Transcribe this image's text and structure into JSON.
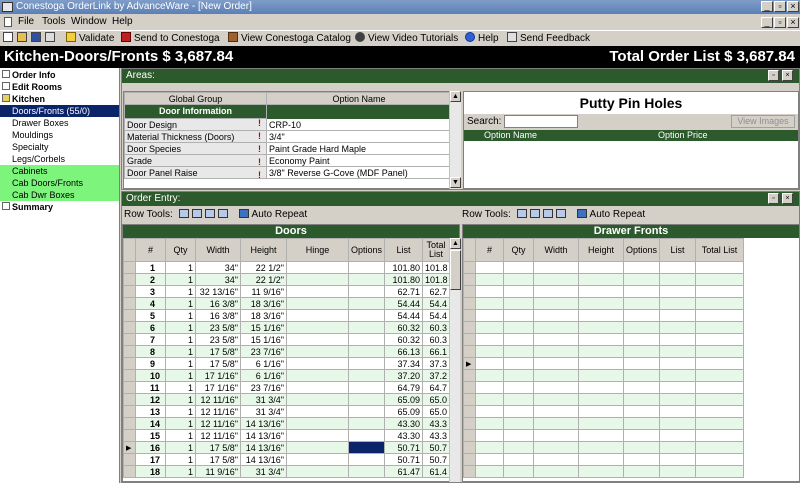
{
  "window": {
    "title": "Conestoga OrderLink by AdvanceWare - [New Order]"
  },
  "menu": {
    "file": "File",
    "tools": "Tools",
    "window": "Window",
    "help": "Help"
  },
  "toolbar": {
    "validate": "Validate",
    "send_to_conestoga": "Send to Conestoga",
    "view_catalog": "View Conestoga Catalog",
    "view_tutorials": "View Video Tutorials",
    "help": "Help",
    "send_feedback": "Send Feedback"
  },
  "header": {
    "left": "Kitchen-Doors/Fronts $ 3,687.84",
    "right": "Total Order List $ 3,687.84"
  },
  "nav": {
    "items": [
      "Order Info",
      "Edit Rooms",
      "Kitchen",
      "Doors/Fronts (55/0)",
      "Drawer Boxes",
      "Mouldings",
      "Specialty",
      "Legs/Corbels",
      "Cabinets",
      "Cab Doors/Fronts",
      "Cab Dwr Boxes",
      "Summary"
    ]
  },
  "areas": {
    "label": "Areas:",
    "col_global": "Global Group",
    "col_option": "Option Name",
    "section": "Door Information",
    "rows": [
      {
        "name": "Door Design",
        "value": "CRP-10"
      },
      {
        "name": "Material Thickness (Doors)",
        "value": "3/4\""
      },
      {
        "name": "Door Species",
        "value": "Paint Grade Hard Maple"
      },
      {
        "name": "Grade",
        "value": "Economy Paint"
      },
      {
        "name": "Door Panel Raise",
        "value": "3/8\" Reverse G-Cove (MDF Panel)"
      }
    ],
    "detail_title": "Putty Pin Holes",
    "search_label": "Search:",
    "view_images": "View Images",
    "col_price_name": "Option Name",
    "col_price": "Option Price"
  },
  "order_entry": {
    "label": "Order Entry:",
    "row_tools": "Row Tools:",
    "auto_repeat": "Auto Repeat",
    "doors_title": "Doors",
    "drawer_title": "Drawer Fronts",
    "doors_cols": [
      "#",
      "Qty",
      "Width",
      "Height",
      "Hinge",
      "Options",
      "List",
      "Total List"
    ],
    "drawer_cols": [
      "#",
      "Qty",
      "Width",
      "Height",
      "Options",
      "List",
      "Total List"
    ],
    "doors_rows": [
      [
        "1",
        "1",
        "34\"",
        "22 1/2\"",
        "",
        "",
        "101.80",
        "101.8"
      ],
      [
        "2",
        "1",
        "34\"",
        "22 1/2\"",
        "",
        "",
        "101.80",
        "101.8"
      ],
      [
        "3",
        "1",
        "32 13/16\"",
        "11 9/16\"",
        "",
        "",
        "62.71",
        "62.7"
      ],
      [
        "4",
        "1",
        "16 3/8\"",
        "18 3/16\"",
        "",
        "",
        "54.44",
        "54.4"
      ],
      [
        "5",
        "1",
        "16 3/8\"",
        "18 3/16\"",
        "",
        "",
        "54.44",
        "54.4"
      ],
      [
        "6",
        "1",
        "23 5/8\"",
        "15 1/16\"",
        "",
        "",
        "60.32",
        "60.3"
      ],
      [
        "7",
        "1",
        "23 5/8\"",
        "15 1/16\"",
        "",
        "",
        "60.32",
        "60.3"
      ],
      [
        "8",
        "1",
        "17 5/8\"",
        "23 7/16\"",
        "",
        "",
        "66.13",
        "66.1"
      ],
      [
        "9",
        "1",
        "17 5/8\"",
        "6 1/16\"",
        "",
        "",
        "37.34",
        "37.3"
      ],
      [
        "10",
        "1",
        "17 1/16\"",
        "6 1/16\"",
        "",
        "",
        "37.20",
        "37.2"
      ],
      [
        "11",
        "1",
        "17 1/16\"",
        "23 7/16\"",
        "",
        "",
        "64.79",
        "64.7"
      ],
      [
        "12",
        "1",
        "12 11/16\"",
        "31 3/4\"",
        "",
        "",
        "65.09",
        "65.0"
      ],
      [
        "13",
        "1",
        "12 11/16\"",
        "31 3/4\"",
        "",
        "",
        "65.09",
        "65.0"
      ],
      [
        "14",
        "1",
        "12 11/16\"",
        "14 13/16\"",
        "",
        "",
        "43.30",
        "43.3"
      ],
      [
        "15",
        "1",
        "12 11/16\"",
        "14 13/16\"",
        "",
        "",
        "43.30",
        "43.3"
      ],
      [
        "16",
        "1",
        "17 5/8\"",
        "14 13/16\"",
        "",
        "",
        "50.71",
        "50.7"
      ],
      [
        "17",
        "1",
        "17 5/8\"",
        "14 13/16\"",
        "",
        "",
        "50.71",
        "50.7"
      ],
      [
        "18",
        "1",
        "11 9/16\"",
        "31 3/4\"",
        "",
        "",
        "61.47",
        "61.4"
      ]
    ]
  },
  "colors": {
    "accent_green": "#2d5a2d",
    "nav_green": "#7df57d",
    "selected": "#0a246a"
  }
}
